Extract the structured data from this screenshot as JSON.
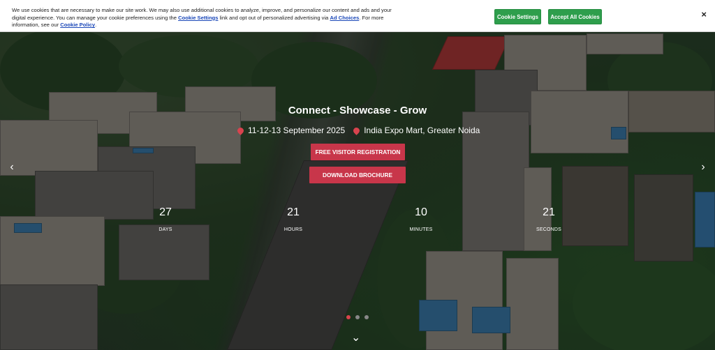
{
  "cookie": {
    "text_1": "We use cookies that are necessary to make our site work. We may also use additional cookies to analyze, improve, and personalize our content and ads and your digital experience. You can manage your cookie preferences using the",
    "link_settings": "Cookie Settings",
    "text_2": "link and opt out of personalized advertising via",
    "link_adchoices": "Ad Choices",
    "text_3": ". For more information, see our",
    "link_policy": "Cookie Policy",
    "text_4": ".",
    "settings_button": "Cookie Settings",
    "accept_button": "Accept All Cookies",
    "close_symbol": "×"
  },
  "hero": {
    "headline": "Connect - Showcase - Grow",
    "dates": "11-12-13 September 2025",
    "venue": "India Expo Mart, Greater Noida",
    "cta_primary": "FREE VISITOR REGISTRATION",
    "cta_secondary": "DOWNLOAD BROCHURE",
    "prev_symbol": "‹",
    "next_symbol": "›",
    "scroll_symbol": "⌄"
  },
  "countdown": [
    {
      "value": "27",
      "label": "DAYS"
    },
    {
      "value": "21",
      "label": "HOURS"
    },
    {
      "value": "10",
      "label": "MINUTES"
    },
    {
      "value": "21",
      "label": "SECONDS"
    }
  ],
  "slider": {
    "active_index": 0,
    "total": 3
  },
  "colors": {
    "accent": "#c8364a",
    "cookie_button": "#2e9e4c",
    "link": "#1a47b8"
  }
}
